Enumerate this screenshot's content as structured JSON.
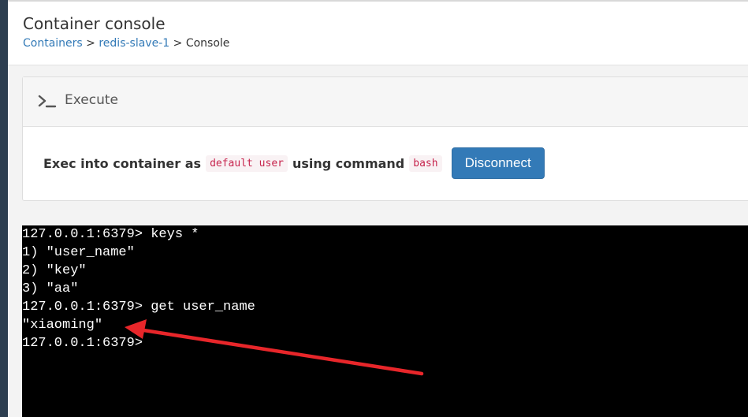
{
  "header": {
    "title": "Container console",
    "breadcrumb": {
      "containers": "Containers",
      "sep1": " > ",
      "container_name": "redis-slave-1",
      "sep2": " > ",
      "current": "Console"
    }
  },
  "widget": {
    "icon": "terminal-icon",
    "title": "Execute",
    "exec_prefix": "Exec into container as",
    "user_code": "default user",
    "exec_middle": "using command",
    "command_code": "bash",
    "disconnect_label": "Disconnect"
  },
  "terminal": {
    "lines": [
      "127.0.0.1:6379> keys *",
      "1) \"user_name\"",
      "2) \"key\"",
      "3) \"aa\"",
      "127.0.0.1:6379> get user_name",
      "\"xiaoming\"",
      "127.0.0.1:6379>"
    ]
  },
  "annotation": {
    "arrow_color": "#e8262a"
  },
  "colors": {
    "sidebar": "#2d3e50",
    "link": "#337ab7",
    "button": "#337ab7",
    "code_text": "#c7254e",
    "terminal_bg": "#000000"
  }
}
